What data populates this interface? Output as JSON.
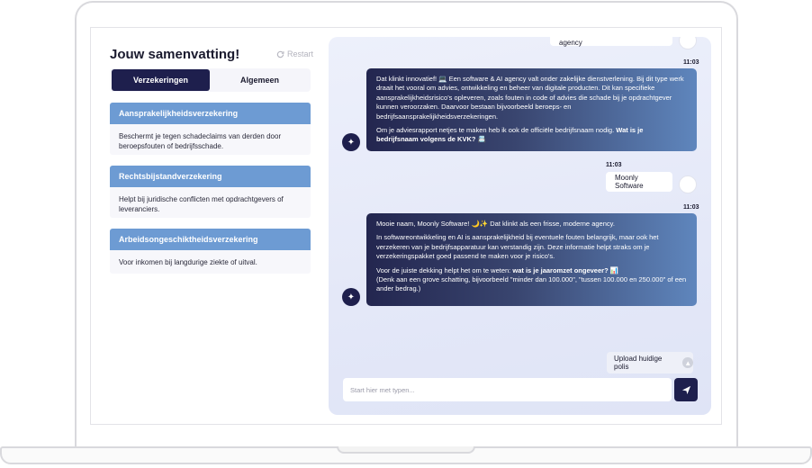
{
  "summary": {
    "title": "Jouw samenvatting!",
    "restart_label": "Restart"
  },
  "tabs": [
    {
      "label": "Verzekeringen",
      "active": true
    },
    {
      "label": "Algemeen",
      "active": false
    }
  ],
  "insurances": [
    {
      "title": "Aansprakelijkheidsverzekering",
      "description": "Beschermt je tegen schadeclaims van derden door beroepsfouten of bedrijfsschade."
    },
    {
      "title": "Rechtsbijstandverzekering",
      "description": "Helpt bij juridische conflicten met opdrachtgevers of leveranciers."
    },
    {
      "title": "Arbeidsongeschiktheidsverzekering",
      "description": "Voor inkomen bij langdurige ziekte of uitval."
    }
  ],
  "chat": {
    "top_user_message": "Ik heb een software en AI agency",
    "bot1": {
      "time": "11:03",
      "p1": "Dat klinkt innovatief! 💻 Een software & AI agency valt onder zakelijke dienstverlening. Bij dit type werk draait het vooral om advies, ontwikkeling en beheer van digitale producten. Dit kan specifieke aansprakelijkheidsrisico's opleveren, zoals fouten in code of advies die schade bij je opdrachtgever kunnen veroorzaken. Daarvoor bestaan bijvoorbeeld beroeps- en bedrijfsaansprakelijkheidsverzekeringen.",
      "p2_prefix": "Om je adviesrapport netjes te maken heb ik ook de officiële bedrijfsnaam nodig. ",
      "p2_bold": "Wat is je bedrijfsnaam volgens de KVK? 📇"
    },
    "user2": {
      "time": "11:03",
      "text": "Moonly Software"
    },
    "bot2": {
      "time": "11:03",
      "p1": "Mooie naam, Moonly Software! 🌙✨ Dat klinkt als een frisse, moderne agency.",
      "p2": "In softwareontwikkeling en AI is aansprakelijkheid bij eventuele fouten belangrijk, maar ook het verzekeren van je bedrijfsapparatuur kan verstandig zijn. Deze informatie helpt straks om je verzekeringspakket goed passend te maken voor je risico's.",
      "p3_prefix": "Voor de juiste dekking helpt het om te weten: ",
      "p3_bold": "wat is je jaaromzet ongeveer? 📊",
      "p3_suffix": "(Denk aan een grove schatting, bijvoorbeeld \"minder dan 100.000\", \"tussen 100.000 en 250.000\" of een ander bedrag.)"
    },
    "upload_label": "Upload huidige polis",
    "input_placeholder": "Start hier met typen..."
  }
}
